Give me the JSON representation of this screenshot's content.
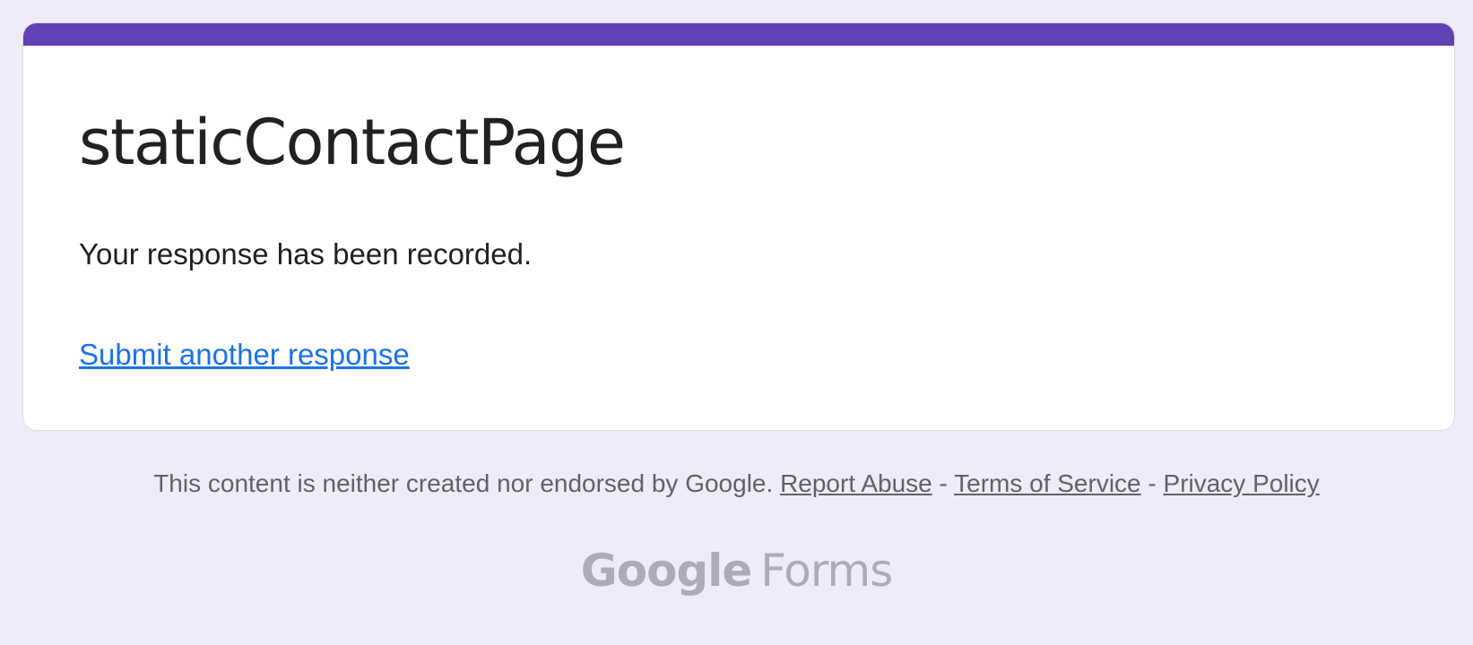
{
  "form": {
    "title": "staticContactPage",
    "confirmation_message": "Your response has been recorded.",
    "submit_another_label": "Submit another response"
  },
  "footer": {
    "disclaimer": "This content is neither created nor endorsed by Google.",
    "separator": "-",
    "report_abuse_label": "Report Abuse",
    "terms_label": "Terms of Service",
    "privacy_label": "Privacy Policy"
  },
  "branding": {
    "company": "Google",
    "product": "Forms"
  },
  "colors": {
    "background": "#efebf8",
    "accent": "#6041b6",
    "link": "#1a73e8",
    "text_primary": "#202124",
    "text_secondary": "#5f6368",
    "logo": "#aeaab8"
  }
}
